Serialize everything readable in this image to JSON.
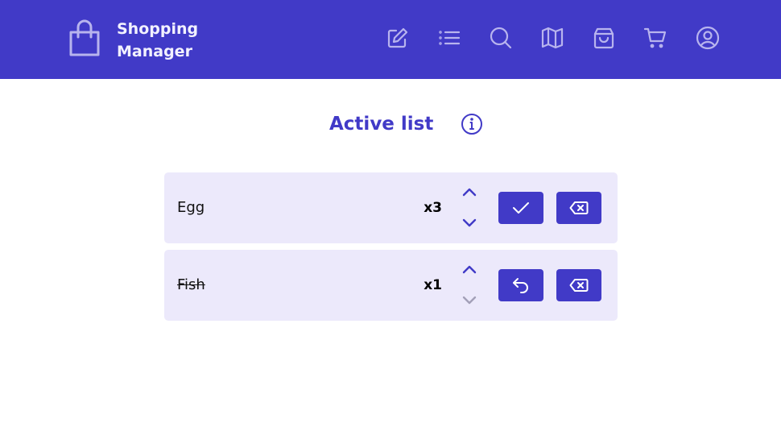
{
  "app": {
    "title_line1": "Shopping",
    "title_line2": "Manager"
  },
  "nav": [
    {
      "icon": "edit-icon"
    },
    {
      "icon": "list-icon"
    },
    {
      "icon": "search-icon"
    },
    {
      "icon": "map-icon"
    },
    {
      "icon": "shopping-bag-icon"
    },
    {
      "icon": "cart-icon"
    },
    {
      "icon": "user-icon"
    }
  ],
  "main": {
    "title": "Active list",
    "info_icon": "info-icon"
  },
  "items": [
    {
      "name": "Egg",
      "quantity": "x3",
      "done": false,
      "action_icon": "check-icon",
      "delete_icon": "backspace-icon",
      "decrement_enabled": true
    },
    {
      "name": "Fish",
      "quantity": "x1",
      "done": true,
      "action_icon": "undo-icon",
      "delete_icon": "backspace-icon",
      "decrement_enabled": false
    }
  ],
  "colors": {
    "primary": "#413ac7",
    "row_background": "#ece9fb",
    "header_icon": "#b8b4ee",
    "disabled": "#a3a0b8"
  }
}
